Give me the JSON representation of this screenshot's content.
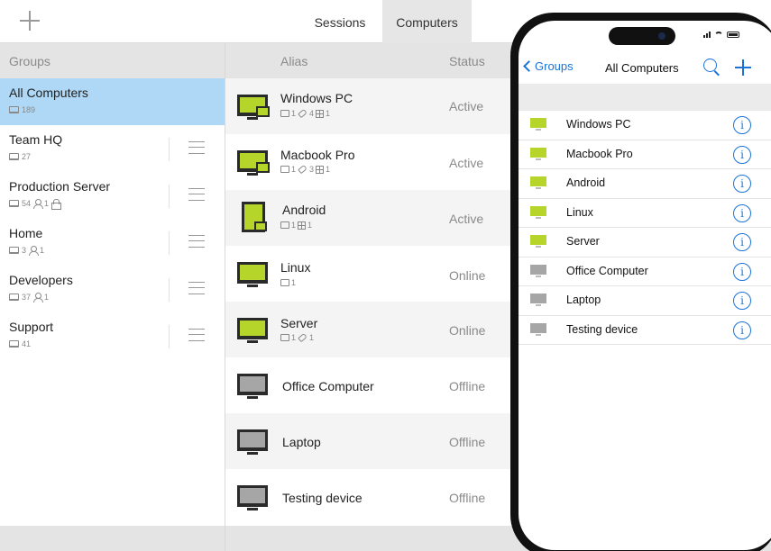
{
  "topbar": {
    "tabs": [
      {
        "label": "Sessions",
        "active": false
      },
      {
        "label": "Computers",
        "active": true
      }
    ]
  },
  "groups": {
    "header": "Groups",
    "items": [
      {
        "name": "All Computers",
        "computers": "189",
        "selected": true
      },
      {
        "name": "Team HQ",
        "computers": "27"
      },
      {
        "name": "Production Server",
        "computers": "54",
        "users": "1",
        "locked": true
      },
      {
        "name": "Home",
        "computers": "3",
        "users": "1"
      },
      {
        "name": "Developers",
        "computers": "37",
        "users": "1"
      },
      {
        "name": "Support",
        "computers": "41"
      }
    ]
  },
  "computers": {
    "header_alias": "Alias",
    "header_status": "Status",
    "rows": [
      {
        "alias": "Windows PC",
        "status": "Active",
        "folders": "1",
        "tags": "4",
        "sessions": "1",
        "icon": "monitor-green-badge"
      },
      {
        "alias": "Macbook Pro",
        "status": "Active",
        "folders": "1",
        "tags": "3",
        "sessions": "1",
        "icon": "monitor-green-badge"
      },
      {
        "alias": "Android",
        "status": "Active",
        "folders": "1",
        "sessions": "1",
        "icon": "tablet-green-badge"
      },
      {
        "alias": "Linux",
        "status": "Online",
        "folders": "1",
        "icon": "monitor-green"
      },
      {
        "alias": "Server",
        "status": "Online",
        "folders": "1",
        "tags": "1",
        "icon": "monitor-green"
      },
      {
        "alias": "Office Computer",
        "status": "Offline",
        "icon": "monitor-gray"
      },
      {
        "alias": "Laptop",
        "status": "Offline",
        "icon": "monitor-gray"
      },
      {
        "alias": "Testing device",
        "status": "Offline",
        "icon": "monitor-gray"
      }
    ]
  },
  "phone": {
    "back_label": "Groups",
    "title": "All Computers",
    "items": [
      {
        "name": "Windows PC",
        "state": "online"
      },
      {
        "name": "Macbook Pro",
        "state": "online"
      },
      {
        "name": "Android",
        "state": "online"
      },
      {
        "name": "Linux",
        "state": "online"
      },
      {
        "name": "Server",
        "state": "online"
      },
      {
        "name": "Office Computer",
        "state": "offline"
      },
      {
        "name": "Laptop",
        "state": "offline"
      },
      {
        "name": "Testing device",
        "state": "offline"
      }
    ]
  },
  "colors": {
    "accent": "#1a73d8",
    "selected_group": "#aed8f6",
    "online_green": "#b5d52a",
    "offline_gray": "#a6a6a6"
  }
}
